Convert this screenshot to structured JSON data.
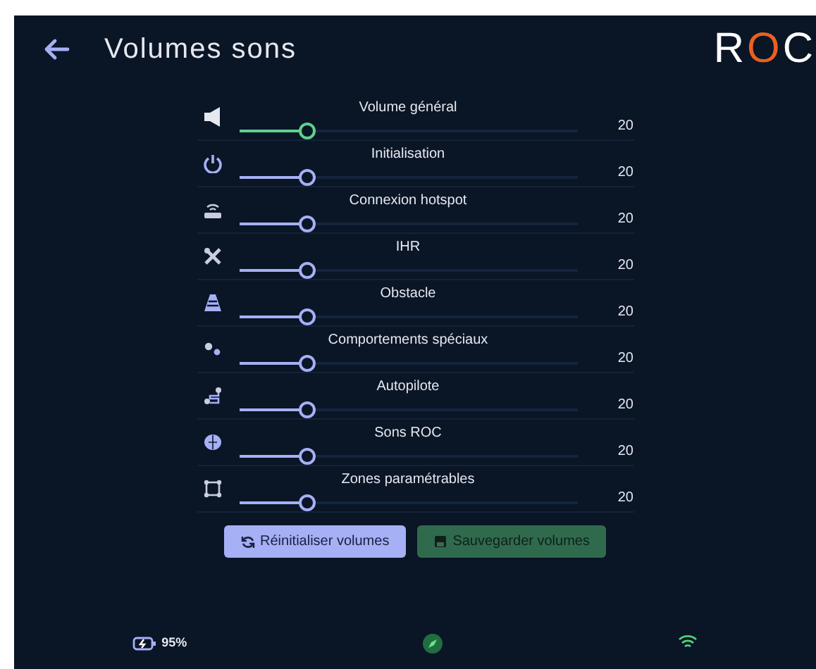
{
  "header": {
    "title": "Volumes sons",
    "logo": [
      "R",
      "O",
      "C"
    ]
  },
  "sliders": [
    {
      "label": "Volume général",
      "level": 0.2,
      "value": "20",
      "color": "#5fd08f"
    },
    {
      "label": "Initialisation",
      "level": 0.2,
      "value": "20",
      "color": "#a5b0f5"
    },
    {
      "label": "Connexion hotspot",
      "level": 0.2,
      "value": "20",
      "color": "#a5b0f5"
    },
    {
      "label": "IHR",
      "level": 0.2,
      "value": "20",
      "color": "#a5b0f5"
    },
    {
      "label": "Obstacle",
      "level": 0.2,
      "value": "20",
      "color": "#a5b0f5"
    },
    {
      "label": "Comportements spéciaux",
      "level": 0.2,
      "value": "20",
      "color": "#a5b0f5"
    },
    {
      "label": "Autopilote",
      "level": 0.2,
      "value": "20",
      "color": "#a5b0f5"
    },
    {
      "label": "Sons ROC",
      "level": 0.2,
      "value": "20",
      "color": "#a5b0f5"
    },
    {
      "label": "Zones paramétrables",
      "level": 0.2,
      "value": "20",
      "color": "#a5b0f5"
    }
  ],
  "buttons": [
    {
      "label": "Réinitialiser volumes",
      "kind": "reset",
      "disabled": false
    },
    {
      "label": "Sauvegarder volumes",
      "kind": "save",
      "disabled": true
    }
  ],
  "status_bar": {
    "battery": "95%"
  }
}
